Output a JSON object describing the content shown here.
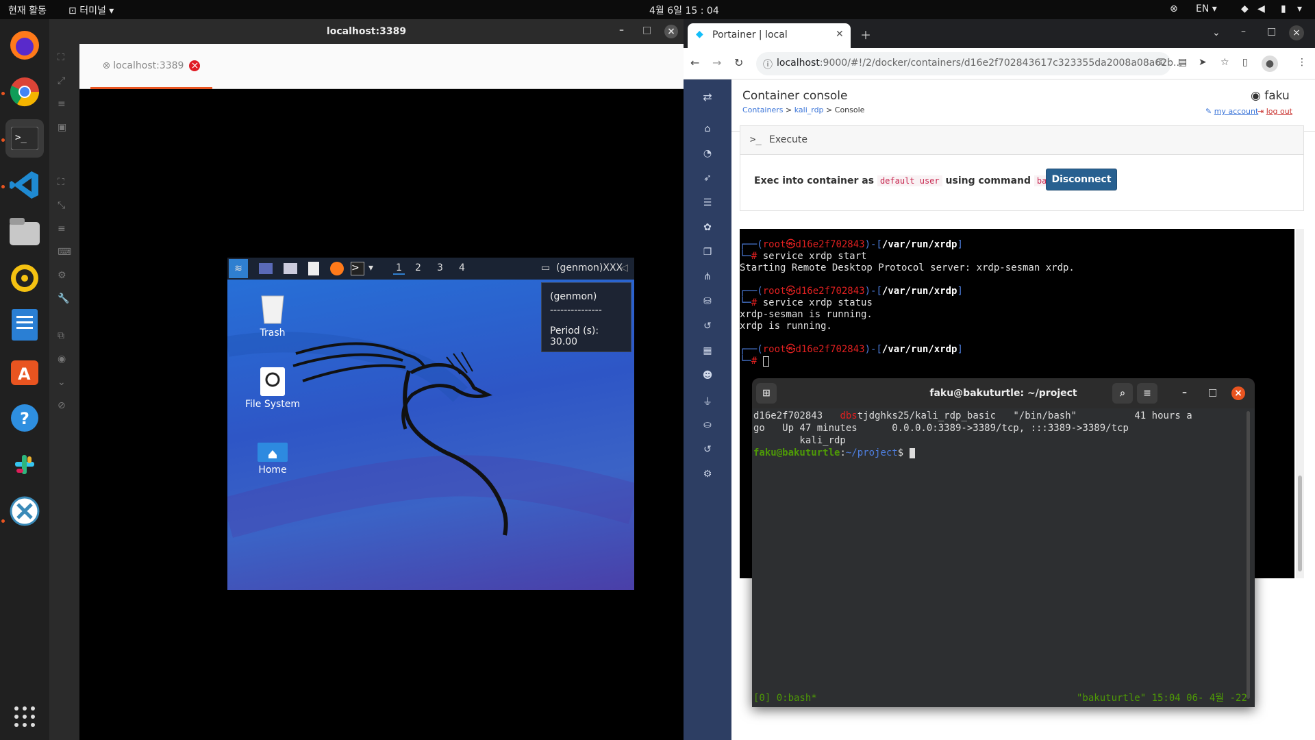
{
  "topbar": {
    "activities": "현재 활동",
    "app": "터미널",
    "clock": "4월 6일 15 : 04",
    "lang": "EN"
  },
  "remmina": {
    "title": "localhost:3389",
    "tab_label": "localhost:3389"
  },
  "kali": {
    "workspaces": [
      "1",
      "2",
      "3",
      "4"
    ],
    "genmon": "(genmon)XXX",
    "icons": {
      "trash": "Trash",
      "filesystem": "File System",
      "home": "Home"
    },
    "tooltip": {
      "title": "(genmon)",
      "divider": "---------------",
      "period": "Period (s): 30.00"
    }
  },
  "chrome": {
    "tab_title": "Portainer | local",
    "url_host": "localhost",
    "url_rest": ":9000/#!/2/docker/containers/d16e2f702843617c323355da2008a08a62b..."
  },
  "portainer": {
    "page_title": "Container console",
    "breadcrumb": {
      "containers": "Containers",
      "sep1": " > ",
      "container": "kali_rdp",
      "sep2": " > ",
      "current": "Console"
    },
    "user": "faku",
    "my_account": "my account",
    "log_out": "log out",
    "execute_label": "Execute",
    "exec_text_1": "Exec into container as",
    "exec_user": "default user",
    "exec_text_2": "using command",
    "exec_cmd": "bash",
    "disconnect": "Disconnect"
  },
  "console": {
    "prompt_user": "root",
    "prompt_at": "㉿",
    "prompt_host": "d16e2f702843",
    "prompt_path": "/var/run/xrdp",
    "cmd1": "service xrdp start",
    "out1": "Starting Remote Desktop Protocol server: xrdp-sesman xrdp.",
    "cmd2": "service xrdp status",
    "out2a": "xrdp-sesman is running.",
    "out2b": "xrdp is running."
  },
  "gterm": {
    "title": "faku@bakuturtle: ~/project",
    "row1_id": "d16e2f702843",
    "row1_img_red": "dbs",
    "row1_img": "tjdghks25/kali_rdp_basic",
    "row1_cmd": "\"/bin/bash\"",
    "row1_created": "41 hours a",
    "row2": "go   Up 47 minutes      0.0.0.0:3389->3389/tcp, :::3389->3389/tcp",
    "row3": "        kali_rdp",
    "prompt_user": "faku@bakuturtle",
    "prompt_path": "~/project",
    "status_left": "[0] 0:bash*",
    "status_right": "\"bakuturtle\" 15:04 06- 4월 -22"
  }
}
